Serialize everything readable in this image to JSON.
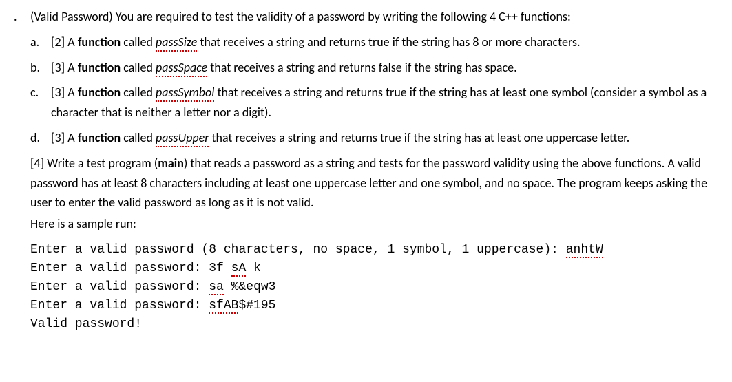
{
  "main": {
    "label": ".",
    "intro": "(Valid Password) You are required to test the validity of a password by writing the following 4 C++ functions:"
  },
  "subs": {
    "a": {
      "label": "a.",
      "points": "[2] A ",
      "bold": "function",
      "mid": " called ",
      "func": "passSize",
      "tail": " that receives a string and returns true if the string has 8 or more characters."
    },
    "b": {
      "label": "b.",
      "points": "[3] A ",
      "bold": "function",
      "mid": " called ",
      "func": "passSpace",
      "tail": " that receives a string and returns false if the string has space."
    },
    "c": {
      "label": "c.",
      "points": "[3] A ",
      "bold": "function",
      "mid": " called ",
      "func": "passSymbol",
      "tail": " that receives a string and returns true if the string has at least one symbol (consider a symbol as a character that is neither a letter nor a digit)."
    },
    "d": {
      "label": "d.",
      "points": "[3] A ",
      "bold": "function",
      "mid": " called ",
      "func": "passUpper",
      "tail": " that receives a string and returns true if the string has at least one uppercase letter."
    }
  },
  "bottom": {
    "pre": "[4] Write a test program (",
    "bold": "main",
    "post": ") that reads a password as a string and tests for the password validity using the above functions. A valid password has at least 8 characters including at least one uppercase letter and one symbol, and no space. The program keeps asking the user to enter the valid password as long as it is not valid.",
    "here": "Here is a sample run:"
  },
  "sample": {
    "l1a": "Enter a valid password (8 characters, no space, 1 symbol, 1 uppercase): ",
    "l1b": "anhtW",
    "l2a": "Enter a valid password: 3f ",
    "l2b": "sA",
    "l2c": " k",
    "l3a": "Enter a valid password: ",
    "l3b": "sa",
    "l3c": " %&eqw3",
    "l4a": "Enter a valid password: ",
    "l4b": "sfAB",
    "l4c": "$#195",
    "l5": "Valid password!"
  }
}
